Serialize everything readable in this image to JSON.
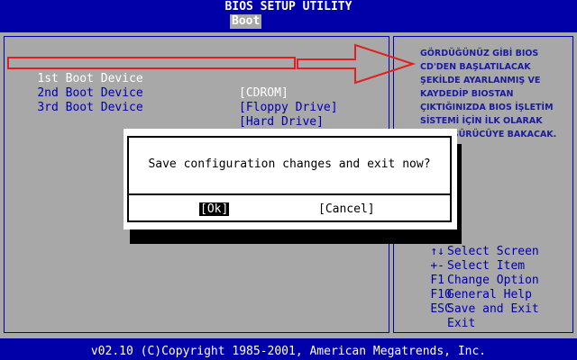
{
  "title": "BIOS SETUP UTILITY",
  "active_tab": "Boot",
  "boot_devices": [
    {
      "label": "1st Boot Device",
      "value": "[CDROM]"
    },
    {
      "label": "2nd Boot Device",
      "value": "[Floppy Drive]"
    },
    {
      "label": "3rd Boot Device",
      "value": "[Hard Drive]"
    }
  ],
  "annotation": "GÖRDÜĞÜNÜZ GİBİ BIOS CD'DEN BAŞLATILACAK ŞEKİLDE AYARLANMIŞ VE KAYDEDİP BIOSTAN ÇIKTIĞINIZDA BIOS İŞLETİM SİSTEMİ İÇİN İLK OLARAK OPTİK SÜRÜCÜYE BAKACAK.",
  "help": [
    {
      "key": "",
      "desc": "Select Screen"
    },
    {
      "key": "↑↓",
      "desc": "Select Item"
    },
    {
      "key": "+-",
      "desc": "Change Option"
    },
    {
      "key": "F1",
      "desc": "General Help"
    },
    {
      "key": "F10",
      "desc": "Save and Exit"
    },
    {
      "key": "ESC",
      "desc": "Exit"
    }
  ],
  "dialog": {
    "message": "Save configuration changes and exit now?",
    "ok_label": "[Ok]",
    "cancel_label": "[Cancel]"
  },
  "footer": "v02.10 (C)Copyright 1985-2001, American Megatrends, Inc.",
  "colors": {
    "background": "#0000a8",
    "panel": "#a8a8a8",
    "highlight_box": "#e02020"
  }
}
